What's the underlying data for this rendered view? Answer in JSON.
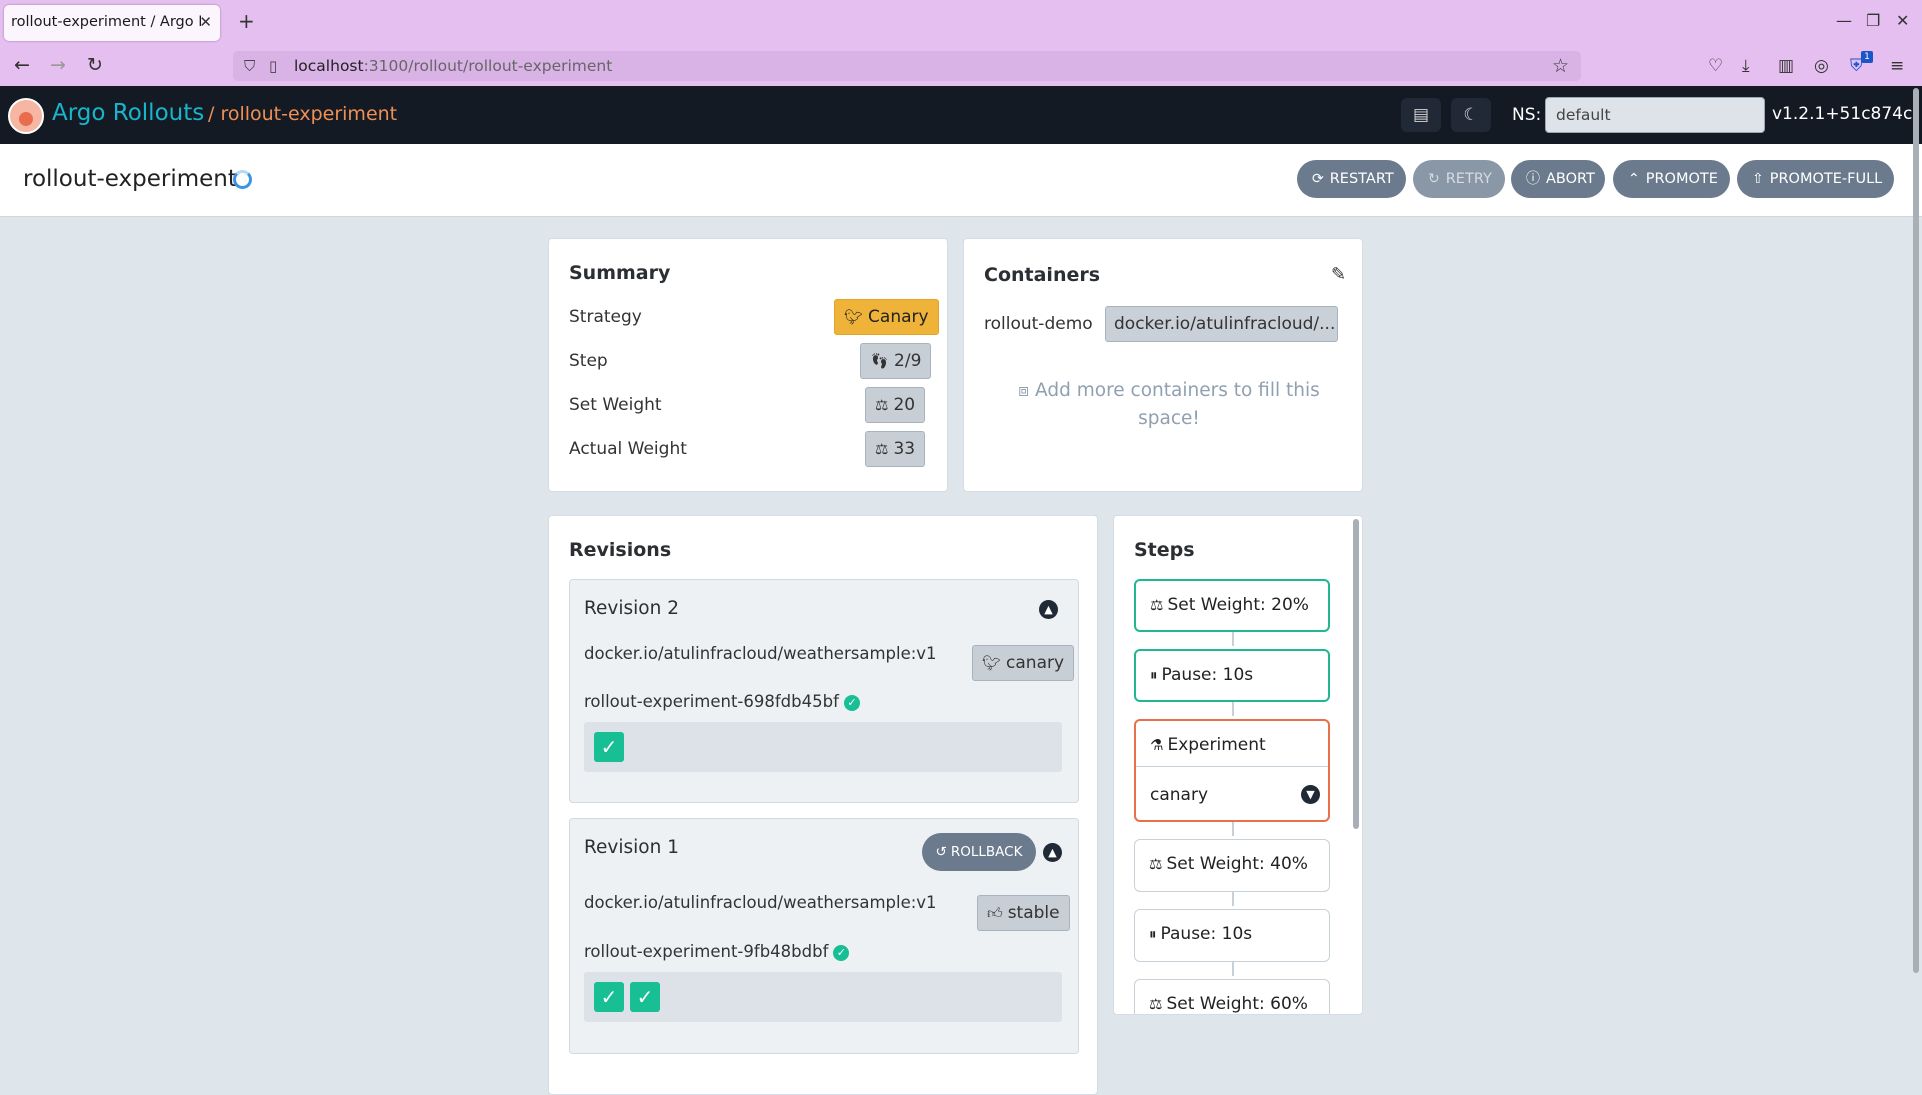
{
  "browser": {
    "tab_title": "rollout-experiment / Argo Ro",
    "url_host": "localhost",
    "url_rest": ":3100/rollout/rollout-experiment",
    "ext_badge": "1"
  },
  "app": {
    "name": "Argo Rollouts",
    "breadcrumb": "/ rollout-experiment",
    "ns_label": "NS:",
    "namespace": "default",
    "version": "v1.2.1+51c874c"
  },
  "rollout": {
    "name": "rollout-experiment",
    "actions": {
      "restart": "RESTART",
      "retry": "RETRY",
      "abort": "ABORT",
      "promote": "PROMOTE",
      "promote_full": "PROMOTE-FULL"
    }
  },
  "summary": {
    "title": "Summary",
    "strategy_label": "Strategy",
    "strategy_value": "Canary",
    "step_label": "Step",
    "step_value": "2/9",
    "set_weight_label": "Set Weight",
    "set_weight_value": "20",
    "actual_weight_label": "Actual Weight",
    "actual_weight_value": "33"
  },
  "containers": {
    "title": "Containers",
    "name": "rollout-demo",
    "image": "docker.io/atulinfracloud/...",
    "empty_message": "Add more containers to fill this space!"
  },
  "revisions": {
    "title": "Revisions",
    "rollback_label": "ROLLBACK",
    "items": [
      {
        "title": "Revision 2",
        "image": "docker.io/atulinfracloud/weathersample:v1",
        "badge": "canary",
        "replicaset": "rollout-experiment-698fdb45bf",
        "pods": 1
      },
      {
        "title": "Revision 1",
        "image": "docker.io/atulinfracloud/weathersample:v1",
        "badge": "stable",
        "replicaset": "rollout-experiment-9fb48bdbf",
        "pods": 2
      }
    ]
  },
  "steps": {
    "title": "Steps",
    "items": [
      {
        "label": "Set Weight: 20%",
        "status": "done",
        "icon": "weight-icon"
      },
      {
        "label": "Pause: 10s",
        "status": "done",
        "icon": "pause-icon"
      },
      {
        "label": "Experiment",
        "status": "active",
        "icon": "flask-icon",
        "sub": "canary"
      },
      {
        "label": "Set Weight: 40%",
        "status": "pending",
        "icon": "weight-icon"
      },
      {
        "label": "Pause: 10s",
        "status": "pending",
        "icon": "pause-icon"
      },
      {
        "label": "Set Weight: 60%",
        "status": "pending",
        "icon": "weight-icon"
      }
    ]
  },
  "colors": {
    "header_bg": "#141a23",
    "brand": "#18b5cc",
    "breadcrumb": "#f08f55",
    "success": "#18be94",
    "active_step": "#e8704a",
    "canary_badge": "#f0b33a"
  }
}
